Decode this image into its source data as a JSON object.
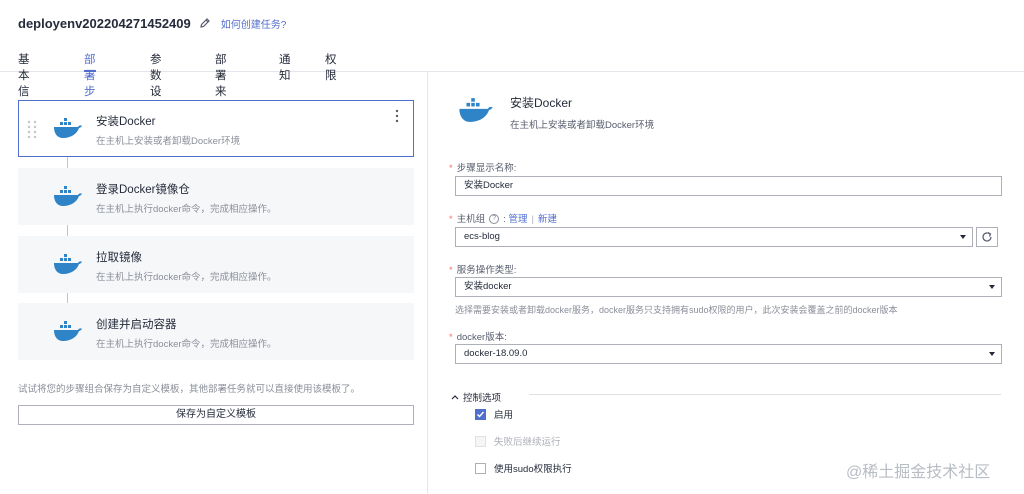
{
  "header": {
    "title": "deployenv202204271452409",
    "help_link": "如何创建任务?",
    "tabs": [
      {
        "label": "基本信息",
        "active": false
      },
      {
        "label": "部署步骤",
        "active": true
      },
      {
        "label": "参数设置",
        "active": false
      },
      {
        "label": "部署来源",
        "active": false
      },
      {
        "label": "通知",
        "active": false
      },
      {
        "label": "权限",
        "active": false
      }
    ]
  },
  "steps": [
    {
      "name": "安装Docker",
      "desc": "在主机上安装或者卸载Docker环境",
      "active": true
    },
    {
      "name": "登录Docker镜像仓",
      "desc": "在主机上执行docker命令，完成相应操作。",
      "active": false
    },
    {
      "name": "拉取镜像",
      "desc": "在主机上执行docker命令，完成相应操作。",
      "active": false
    },
    {
      "name": "创建并启动容器",
      "desc": "在主机上执行docker命令，完成相应操作。",
      "active": false
    }
  ],
  "left_footer": {
    "tip": "试试将您的步骤组合保存为自定义模板，其他部署任务就可以直接使用该模板了。",
    "save_button": "保存为自定义模板"
  },
  "detail": {
    "title": "安装Docker",
    "desc": "在主机上安装或者卸载Docker环境",
    "fields": {
      "display_name": {
        "label": "步骤显示名称:",
        "value": "安装Docker"
      },
      "host_group": {
        "label": "主机组",
        "manage_link": "管理",
        "separator": "|",
        "new_link": "新建",
        "value": "ecs-blog"
      },
      "operation_type": {
        "label": "服务操作类型:",
        "value": "安装docker",
        "hint": "选择需要安装或者卸载docker服务，docker服务只支持拥有sudo权限的用户，此次安装会覆盖之前的docker版本"
      },
      "docker_version": {
        "label": "docker版本:",
        "value": "docker-18.09.0"
      }
    },
    "control": {
      "title": "控制选项",
      "options": [
        {
          "label": "启用",
          "checked": true,
          "disabled": false
        },
        {
          "label": "失败后继续运行",
          "checked": false,
          "disabled": true
        },
        {
          "label": "使用sudo权限执行",
          "checked": false,
          "disabled": false
        }
      ]
    }
  },
  "watermark": "@稀土掘金技术社区",
  "colors": {
    "accent": "#526ecc",
    "docker_blue": "#2e84c6",
    "required": "#f66f6a"
  }
}
